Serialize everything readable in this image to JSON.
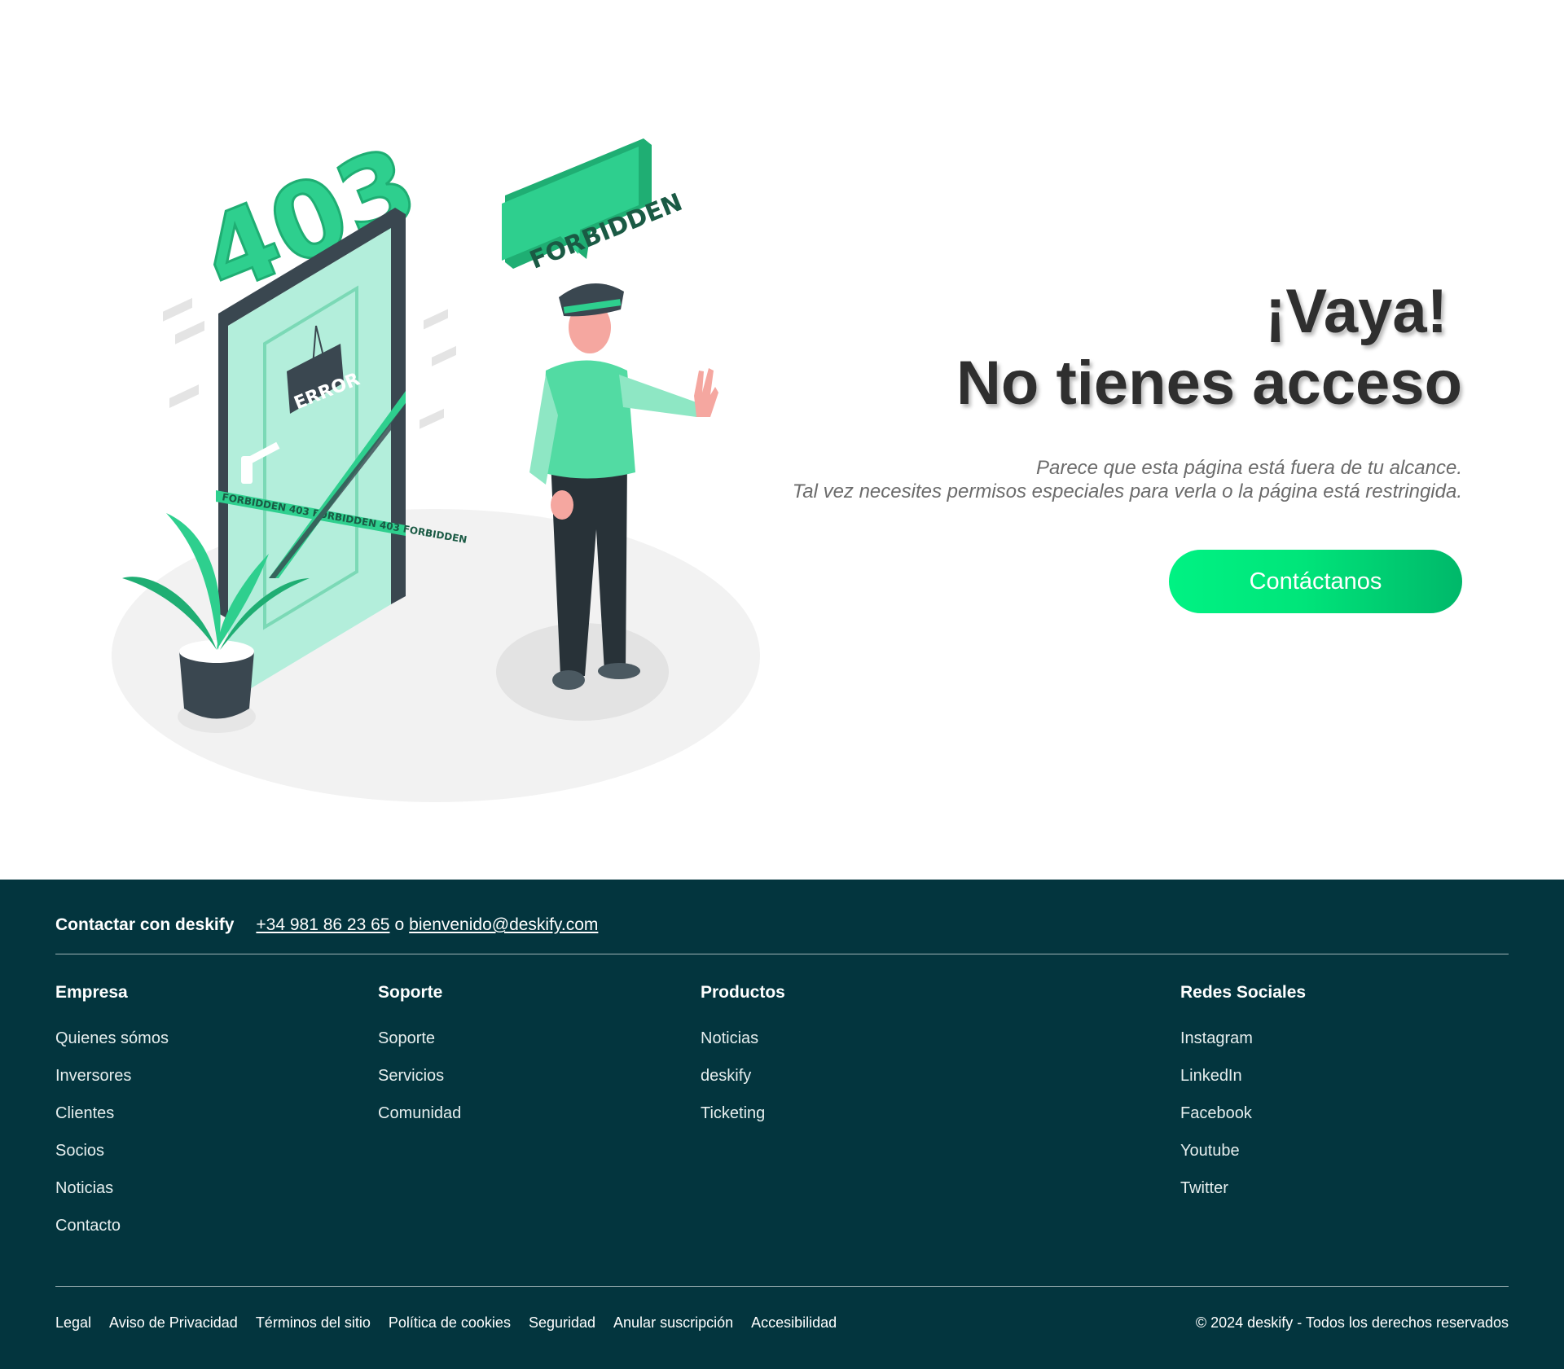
{
  "illustration": {
    "number": "403",
    "bubble": "FORBIDDEN",
    "sign": "ERROR",
    "tape": "FORBIDDEN 403 FORBIDDEN 403 FORBIDDEN",
    "colors": {
      "accent": "#2ecf8e",
      "accent_dark": "#1fae73",
      "dark": "#3a4750",
      "light_green": "#b3eedb",
      "floor": "#f2f2f2"
    }
  },
  "hero": {
    "title_line1": "¡Vaya!",
    "title_line2": "No tienes acceso",
    "subtitle_line1": "Parece que esta página está fuera de tu alcance.",
    "subtitle_line2": "Tal vez necesites permisos especiales para verla o la página está restringida.",
    "cta_label": "Contáctanos"
  },
  "footer": {
    "contact_title": "Contactar con deskify",
    "phone": "+34 981 86 23 65",
    "separator": "o",
    "email": "bienvenido@deskify.com",
    "columns": [
      {
        "title": "Empresa",
        "items": [
          "Quienes sómos",
          "Inversores",
          "Clientes",
          "Socios",
          "Noticias",
          "Contacto"
        ]
      },
      {
        "title": "Soporte",
        "items": [
          "Soporte",
          "Servicios",
          "Comunidad"
        ]
      },
      {
        "title": "Productos",
        "items": [
          "Noticias",
          "deskify",
          "Ticketing"
        ]
      },
      {
        "title": "Redes Sociales",
        "items": [
          "Instagram",
          "LinkedIn",
          "Facebook",
          "Youtube",
          "Twitter"
        ]
      }
    ],
    "legal_links": [
      "Legal",
      "Aviso de Privacidad",
      "Términos del sitio",
      "Política de cookies",
      "Seguridad",
      "Anular suscripción",
      "Accesibilidad"
    ],
    "copyright": "© 2024 deskify - Todos los derechos reservados",
    "background": "#03353e"
  }
}
